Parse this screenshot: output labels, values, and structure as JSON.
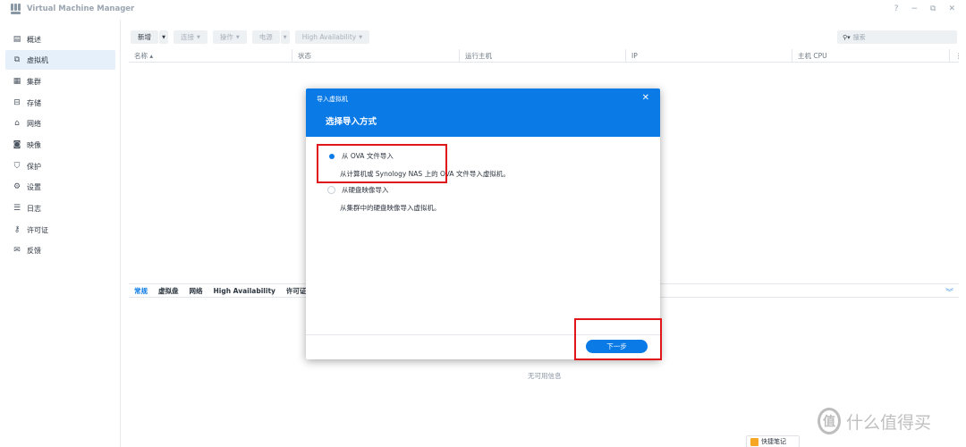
{
  "app": {
    "title": "Virtual Machine Manager",
    "window_controls": [
      "?",
      "−",
      "⧉",
      "✕"
    ]
  },
  "sidebar": {
    "items": [
      {
        "label": "概述",
        "icon": "overview-icon",
        "glyph": "▤"
      },
      {
        "label": "虚拟机",
        "icon": "vm-icon",
        "glyph": "⧉",
        "active": true
      },
      {
        "label": "集群",
        "icon": "cluster-icon",
        "glyph": "▦"
      },
      {
        "label": "存储",
        "icon": "storage-icon",
        "glyph": "⊟"
      },
      {
        "label": "网络",
        "icon": "network-icon",
        "glyph": "⌂"
      },
      {
        "label": "映像",
        "icon": "image-icon",
        "glyph": "◙"
      },
      {
        "label": "保护",
        "icon": "shield-icon",
        "glyph": "⛉"
      },
      {
        "label": "设置",
        "icon": "gear-icon",
        "glyph": "⚙"
      },
      {
        "label": "日志",
        "icon": "log-icon",
        "glyph": "☰"
      },
      {
        "label": "许可证",
        "icon": "key-icon",
        "glyph": "⚷"
      },
      {
        "label": "反馈",
        "icon": "feedback-icon",
        "glyph": "✉"
      }
    ]
  },
  "toolbar": {
    "new_label": "新增",
    "connect_label": "连接",
    "action_label": "操作",
    "power_label": "电源",
    "ha_label": "High Availability",
    "search_placeholder": "搜索"
  },
  "grid": {
    "columns": [
      {
        "label": "名称 ▴",
        "width": 183
      },
      {
        "label": "状态",
        "width": 187
      },
      {
        "label": "运行主机",
        "width": 186
      },
      {
        "label": "IP",
        "width": 186
      },
      {
        "label": "主机 CPU",
        "width": 186
      }
    ]
  },
  "details": {
    "tabs": [
      "常规",
      "虚拟盘",
      "网络",
      "High Availability",
      "许可证"
    ],
    "no_info": "无可用信息"
  },
  "modal": {
    "header_small": "导入虚拟机",
    "title": "选择导入方式",
    "options": [
      {
        "label": "从 OVA 文件导入",
        "desc": "从计算机或 Synology NAS 上的 OVA 文件导入虚拟机。",
        "checked": true
      },
      {
        "label": "从硬盘映像导入",
        "desc": "从集群中的硬盘映像导入虚拟机。",
        "checked": false
      }
    ],
    "next_label": "下一步"
  },
  "watermark": {
    "text": "什么值得买",
    "logo": "值"
  },
  "quicknote": {
    "label": "快捷笔记"
  },
  "colors": {
    "accent": "#0a7ae6",
    "highlight": "#e0161b"
  }
}
